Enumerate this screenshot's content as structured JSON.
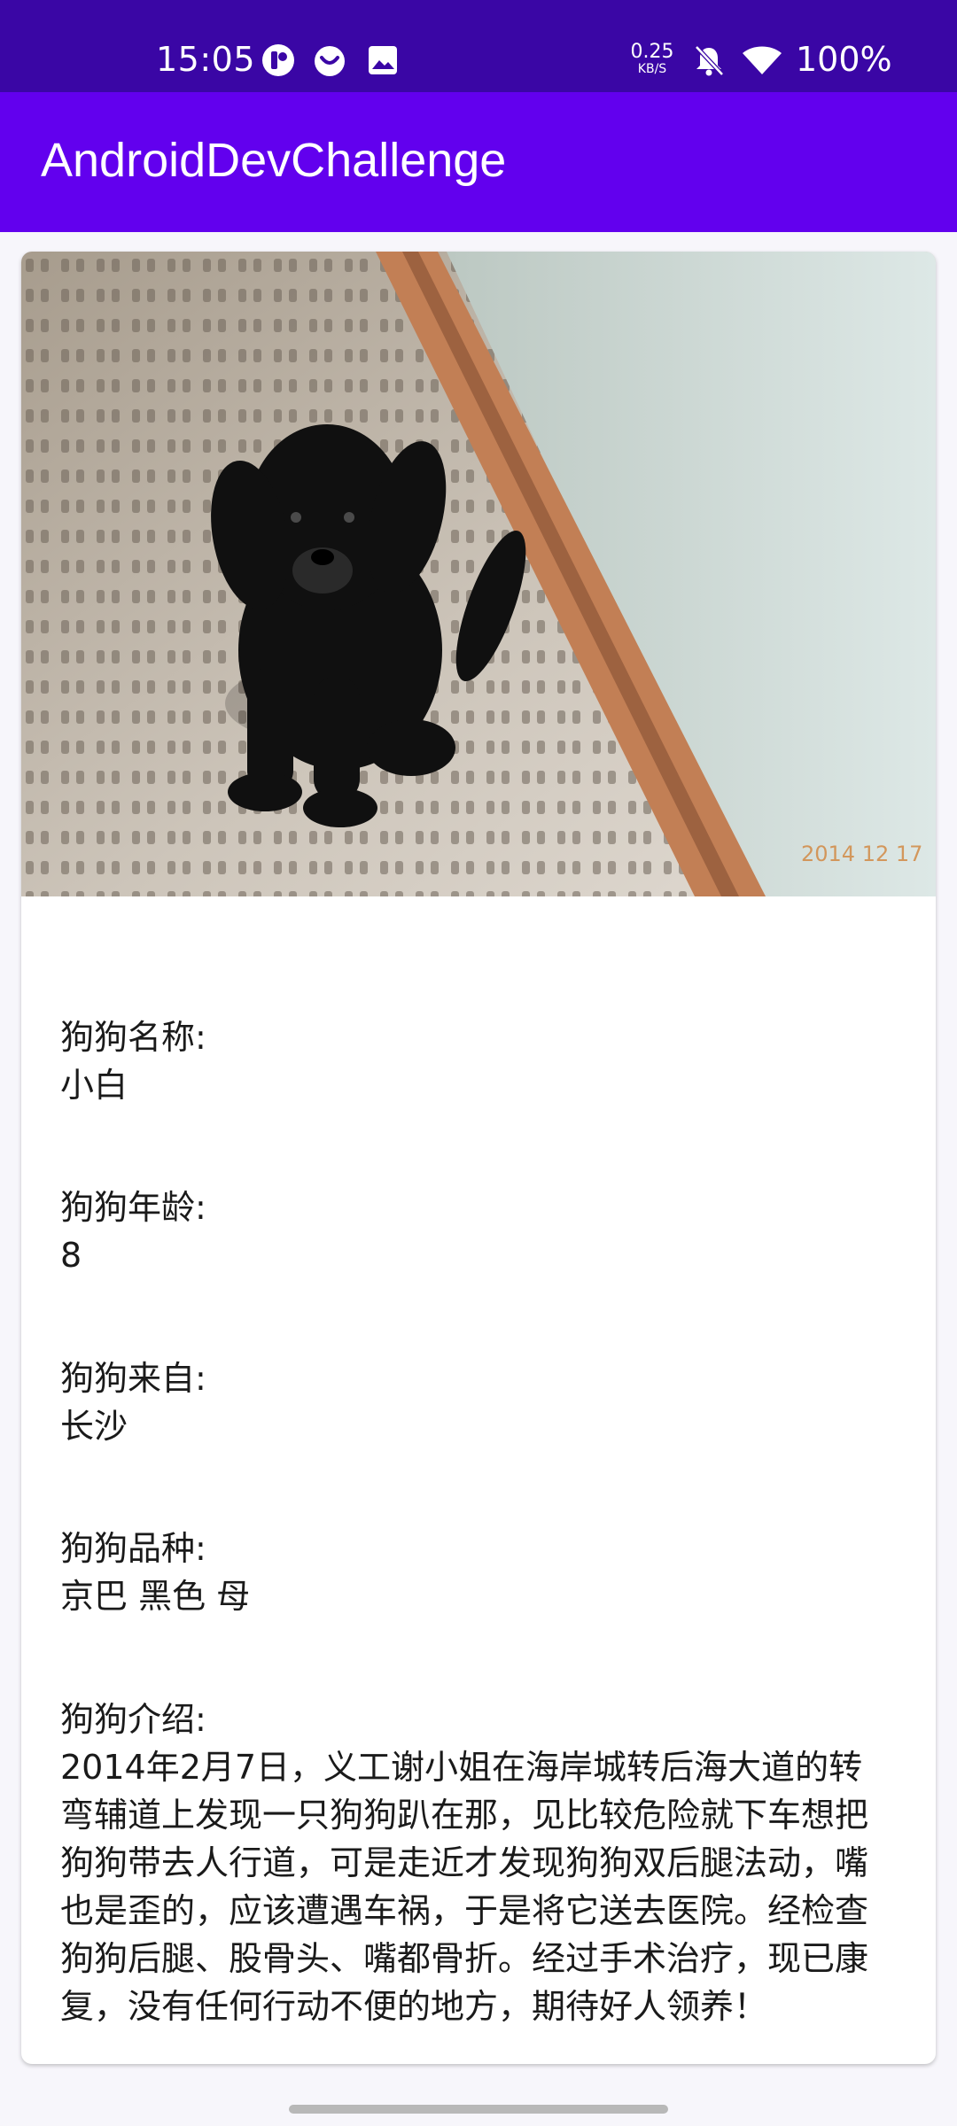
{
  "status_bar": {
    "time": "15:05",
    "net_speed_value": "0.25",
    "net_speed_unit": "KB/S",
    "battery": "100%",
    "icons": [
      "app-notification-icon",
      "smiley-notification-icon",
      "image-notification-icon",
      "bell-off-icon",
      "wifi-icon"
    ]
  },
  "app_bar": {
    "title": "AndroidDevChallenge"
  },
  "dog": {
    "photo_stamp": "2014 12 17",
    "fields": [
      {
        "label": "狗狗名称:",
        "value": "小白"
      },
      {
        "label": "狗狗年龄:",
        "value": "8"
      },
      {
        "label": "狗狗来自:",
        "value": "长沙"
      },
      {
        "label": "狗狗品种:",
        "value": "京巴 黑色 母"
      },
      {
        "label": "狗狗介绍:",
        "value": "2014年2月7日，义工谢小姐在海岸城转后海大道的转\n弯辅道上发现一只狗狗趴在那，见比较危险就下车想把\n狗狗带去人行道，可是走近才发现狗狗双后腿法动，嘴\n也是歪的，应该遭遇车祸，于是将它送去医院。经检查\n狗狗后腿、股骨头、嘴都骨折。经过手术治疗，现已康\n复，没有任何行动不便的地方，期待好人领养！"
      }
    ]
  },
  "colors": {
    "status_bar": "#3a06a5",
    "app_bar": "#6200ee",
    "text": "#1a1a1a"
  }
}
